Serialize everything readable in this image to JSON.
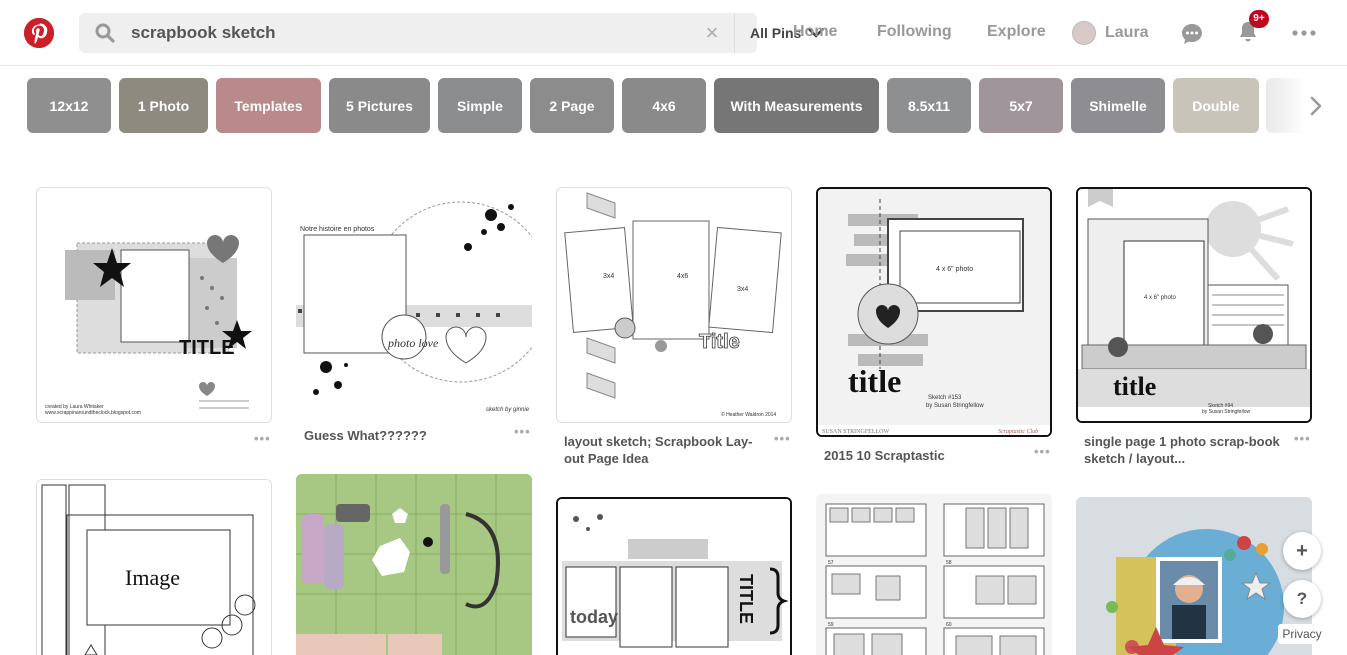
{
  "search": {
    "value": "scrapbook sketch",
    "scope": "All Pins"
  },
  "nav": {
    "home": "Home",
    "following": "Following",
    "explore": "Explore",
    "user": "Laura",
    "notifications_badge": "9+"
  },
  "guides": [
    {
      "label": "12x12",
      "color": "#8f8f8f"
    },
    {
      "label": "1 Photo",
      "color": "#8e8a80"
    },
    {
      "label": "Templates",
      "color": "#b98a89"
    },
    {
      "label": "5 Pictures",
      "color": "#8a8a8a"
    },
    {
      "label": "Simple",
      "color": "#8a8c8e"
    },
    {
      "label": "2 Page",
      "color": "#8c8c8c"
    },
    {
      "label": "4x6",
      "color": "#8a8a8a"
    },
    {
      "label": "With Measurements",
      "color": "#767676"
    },
    {
      "label": "8.5x11",
      "color": "#8d8f90"
    },
    {
      "label": "5x7",
      "color": "#a0959a"
    },
    {
      "label": "Shimelle",
      "color": "#8e8e92"
    },
    {
      "label": "Double",
      "color": "#c9c4ba"
    }
  ],
  "pins": [
    {
      "title": "",
      "image_text": [
        "TITLE",
        "created by Laura Whitaker",
        "www.scrappinaroundtheclock.blogspot.com"
      ]
    },
    {
      "title": "Guess What??????",
      "image_text": [
        "Notre histoire en photos",
        "photo love",
        "sketch by ginnie"
      ]
    },
    {
      "title": "layout sketch; Scrapbook Lay-out Page Idea",
      "image_text": [
        "3x4",
        "4x6",
        "3x4",
        "Title",
        "© Heather Waldron 2014"
      ]
    },
    {
      "title": "2015 10 Scraptastic",
      "image_text": [
        "4 x 6\" photo",
        "title",
        "Sketch #153",
        "by Susan Stringfellow",
        "SUSAN STRINGFELLOW",
        "Scraptastic Club"
      ]
    },
    {
      "title": "single page 1 photo scrap-book sketch / layout...",
      "image_text": [
        "4 x 6\" photo",
        "title",
        "Sketch #94",
        "by Susan Stringfellow"
      ]
    },
    {
      "title": "",
      "image_text": [
        "Image"
      ]
    },
    {
      "title": "",
      "image_text": []
    },
    {
      "title": "",
      "image_text": [
        "today",
        "TITLE"
      ]
    },
    {
      "title": "",
      "image_text": [
        "57",
        "58",
        "59",
        "60"
      ]
    },
    {
      "title": "",
      "image_text": []
    }
  ],
  "more_label": "•••",
  "side": {
    "add": "+",
    "help": "?",
    "privacy": "Privacy"
  }
}
